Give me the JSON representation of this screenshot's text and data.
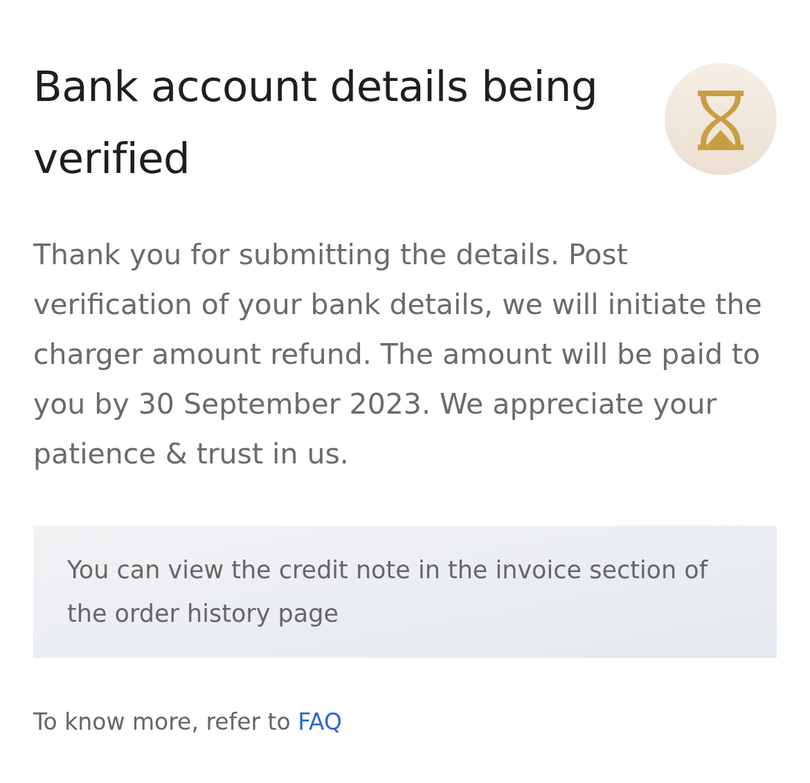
{
  "header": {
    "title": "Bank account details being verified"
  },
  "message": "Thank you for submitting the details. Post verification of your bank details, we will initiate the charger amount refund. The amount will be paid to you by 30 September 2023. We appreciate your patience & trust in us.",
  "note": {
    "text": "You can view the credit note in the invoice section of the order history page"
  },
  "footer": {
    "text": "To know more, refer to",
    "link": "FAQ"
  }
}
